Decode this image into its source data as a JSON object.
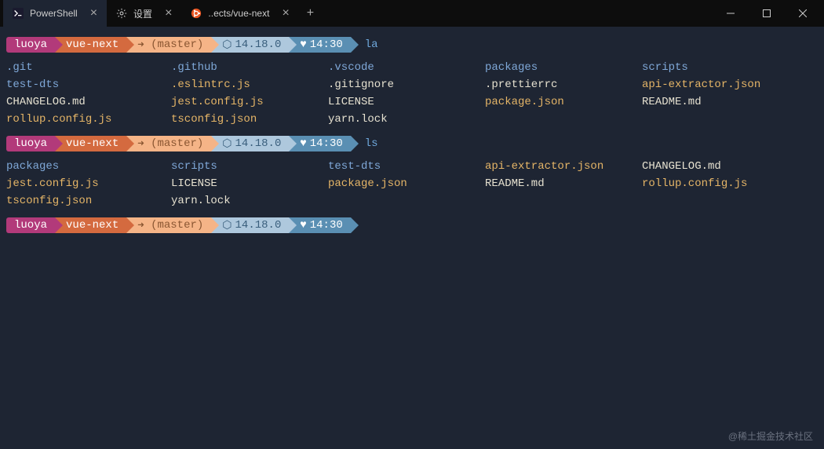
{
  "titlebar": {
    "tabs": [
      {
        "label": "PowerShell",
        "icon": "powershell"
      },
      {
        "label": "设置",
        "icon": "gear"
      },
      {
        "label": "..ects/vue-next",
        "icon": "ubuntu"
      }
    ],
    "newTab": "+"
  },
  "prompts": [
    {
      "user": "luoya",
      "repo": "vue-next",
      "arrow": "➜",
      "branch": "(master)",
      "node": "14.18.0",
      "time": "14:30",
      "command": "la"
    },
    {
      "user": "luoya",
      "repo": "vue-next",
      "arrow": "➜",
      "branch": "(master)",
      "node": "14.18.0",
      "time": "14:30",
      "command": "ls"
    },
    {
      "user": "luoya",
      "repo": "vue-next",
      "arrow": "➜",
      "branch": "(master)",
      "node": "14.18.0",
      "time": "14:30",
      "command": ""
    }
  ],
  "outputs": {
    "la": [
      {
        "t": ".git",
        "c": "dir"
      },
      {
        "t": ".github",
        "c": "dir"
      },
      {
        "t": ".vscode",
        "c": "dir"
      },
      {
        "t": "packages",
        "c": "dir"
      },
      {
        "t": "scripts",
        "c": "dir"
      },
      {
        "t": "test-dts",
        "c": "dir"
      },
      {
        "t": ".eslintrc.js",
        "c": "file-hl"
      },
      {
        "t": ".gitignore",
        "c": "file"
      },
      {
        "t": ".prettierrc",
        "c": "file"
      },
      {
        "t": "api-extractor.json",
        "c": "file-hl"
      },
      {
        "t": "CHANGELOG.md",
        "c": "file"
      },
      {
        "t": "jest.config.js",
        "c": "file-hl"
      },
      {
        "t": "LICENSE",
        "c": "file"
      },
      {
        "t": "package.json",
        "c": "file-hl"
      },
      {
        "t": "README.md",
        "c": "file"
      },
      {
        "t": "rollup.config.js",
        "c": "file-hl"
      },
      {
        "t": "tsconfig.json",
        "c": "file-hl"
      },
      {
        "t": "yarn.lock",
        "c": "file"
      }
    ],
    "ls": [
      {
        "t": "packages",
        "c": "dir"
      },
      {
        "t": "scripts",
        "c": "dir"
      },
      {
        "t": "test-dts",
        "c": "dir"
      },
      {
        "t": "api-extractor.json",
        "c": "file-hl"
      },
      {
        "t": "CHANGELOG.md",
        "c": "file"
      },
      {
        "t": "jest.config.js",
        "c": "file-hl"
      },
      {
        "t": "LICENSE",
        "c": "file"
      },
      {
        "t": "package.json",
        "c": "file-hl"
      },
      {
        "t": "README.md",
        "c": "file"
      },
      {
        "t": "rollup.config.js",
        "c": "file-hl"
      },
      {
        "t": "tsconfig.json",
        "c": "file-hl"
      },
      {
        "t": "yarn.lock",
        "c": "file"
      }
    ]
  },
  "watermark": "@稀土掘金技术社区"
}
